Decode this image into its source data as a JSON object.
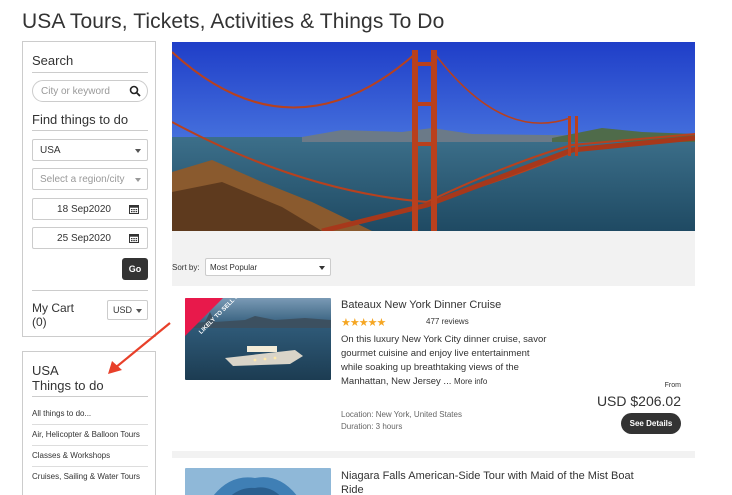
{
  "page": {
    "title": "USA Tours, Tickets, Activities & Things To Do"
  },
  "sidebar": {
    "search_heading": "Search",
    "search_placeholder": "City or keyword",
    "find_heading": "Find things to do",
    "country_value": "USA",
    "region_placeholder": "Select a region/city",
    "start_date": "18 Sep2020",
    "end_date": "25 Sep2020",
    "go_label": "Go",
    "cart_label": "My Cart",
    "cart_count": "(0)",
    "currency": "USD",
    "categories_title_line1": "USA",
    "categories_title_line2": "Things to do",
    "categories": [
      "All things to do...",
      "Air, Helicopter & Balloon Tours",
      "Classes & Workshops",
      "Cruises, Sailing & Water Tours"
    ]
  },
  "sort": {
    "label": "Sort by:",
    "value": "Most Popular"
  },
  "tours": [
    {
      "badge": "LIKELY TO SELL OUT",
      "title": "Bateaux New York Dinner Cruise",
      "stars": "★★★★★",
      "reviews": "477 reviews",
      "description": "On this luxury New York City dinner cruise, savor gourmet cuisine and enjoy live entertainment while soaking up breathtaking views of the Manhattan, New Jersey ...",
      "more_info": "More info",
      "location": "Location: New York, United States",
      "duration": "Duration: 3 hours",
      "from_label": "From",
      "price": "USD $206.02",
      "button": "See Details"
    },
    {
      "title_line1": "Niagara Falls American-Side Tour with Maid of the Mist Boat",
      "title_line2": "Ride"
    }
  ],
  "colors": {
    "accent": "#333333",
    "stars": "#f5a623",
    "badge": "#e8194b",
    "arrow": "#e8402a"
  }
}
